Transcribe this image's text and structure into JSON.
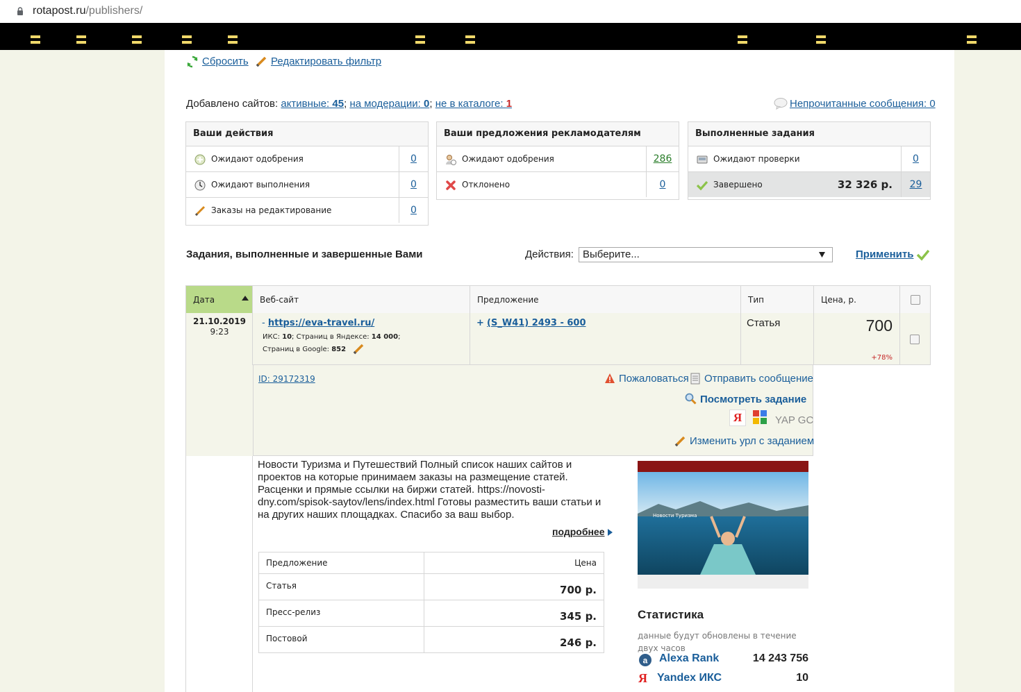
{
  "browser": {
    "url_host": "rotapost.ru",
    "url_path": "/publishers/"
  },
  "filter": {
    "reset": "Сбросить",
    "edit": "Редактировать фильтр"
  },
  "sites": {
    "prefix": "Добавлено сайтов:",
    "active_label": "активные:",
    "active_count": "45",
    "moderation_label": "на модерации:",
    "moderation_count": "0",
    "not_in_catalog_label": "не в каталоге:",
    "not_in_catalog_count": "1",
    "sep": ";",
    "unread": "Непрочитанные сообщения: 0"
  },
  "boxes": {
    "actions": {
      "title": "Ваши действия",
      "rows": [
        {
          "label": "Ожидают одобрения",
          "count": "0",
          "icon": "plus-circle-icon"
        },
        {
          "label": "Ожидают выполнения",
          "count": "0",
          "icon": "clock-icon"
        },
        {
          "label": "Заказы на редактирование",
          "count": "0",
          "icon": "pencil-icon"
        }
      ]
    },
    "offers": {
      "title": "Ваши предложения рекламодателям",
      "rows": [
        {
          "label": "Ожидают одобрения",
          "count": "286",
          "icon": "user-wait-icon"
        },
        {
          "label": "Отклонено",
          "count": "0",
          "icon": "reject-icon"
        }
      ]
    },
    "completed": {
      "title": "Выполненные задания",
      "rows": [
        {
          "label": "Ожидают проверки",
          "count": "0",
          "icon": "inspect-icon"
        },
        {
          "label": "Завершено",
          "amount": "32 326 р.",
          "count": "29",
          "icon": "check-icon"
        }
      ]
    }
  },
  "tasks": {
    "title": "Задания, выполненные и завершенные Вами",
    "actions_label": "Действия:",
    "select_value": "Выберите...",
    "apply": "Применить"
  },
  "table": {
    "headers": [
      "Дата",
      "Веб-сайт",
      "Предложение",
      "Тип",
      "Цена, р."
    ],
    "row": {
      "date": "21.10.2019",
      "time": "9:23",
      "site_prefix": "-",
      "site_url": "https://eva-travel.ru/",
      "iks_label": "ИКС:",
      "iks": "10",
      "yandex_pages_label": "Страниц в Яндексе:",
      "yandex_pages": "14 000",
      "google_pages_label": "Страниц в Google:",
      "google_pages": "852",
      "offer_prefix": "+",
      "offer": "(S_W41) 2493 - 600",
      "type": "Статья",
      "price": "700",
      "price_change": "+78%"
    },
    "detail": {
      "id": "ID: 29172319",
      "complain": "Пожаловаться",
      "send_message": "Отправить сообщение",
      "view_task": "Посмотреть задание",
      "yap_gc": "YAP GC",
      "change_url": "Изменить урл с заданием"
    }
  },
  "site_info": {
    "description": "Новости Туризма и Путешествий Полный список наших сайтов и проектов на которые принимаем заказы на размещение статей. Расценки и прямые ссылки на биржи статей. https://novosti-dny.com/spisok-saytov/lens/index.html Готовы разместить ваши статьи и на других наших площадках. Спасибо за ваш выбор.",
    "more": "подробнее",
    "offers_header": {
      "name": "Предложение",
      "price": "Цена"
    },
    "offers": [
      {
        "name": "Статья",
        "price": "700 р."
      },
      {
        "name": "Пресс-релиз",
        "price": "345 р."
      },
      {
        "name": "Постовой",
        "price": "246 р."
      }
    ],
    "screenshot_caption": "Новости Туризма"
  },
  "stats": {
    "title": "Статистика",
    "note": "данные будут обновлены в течение двух часов",
    "rows": [
      {
        "label": "Alexa Rank",
        "value": "14 243 756"
      },
      {
        "label": "Yandex ИКС",
        "value": "10"
      }
    ]
  }
}
